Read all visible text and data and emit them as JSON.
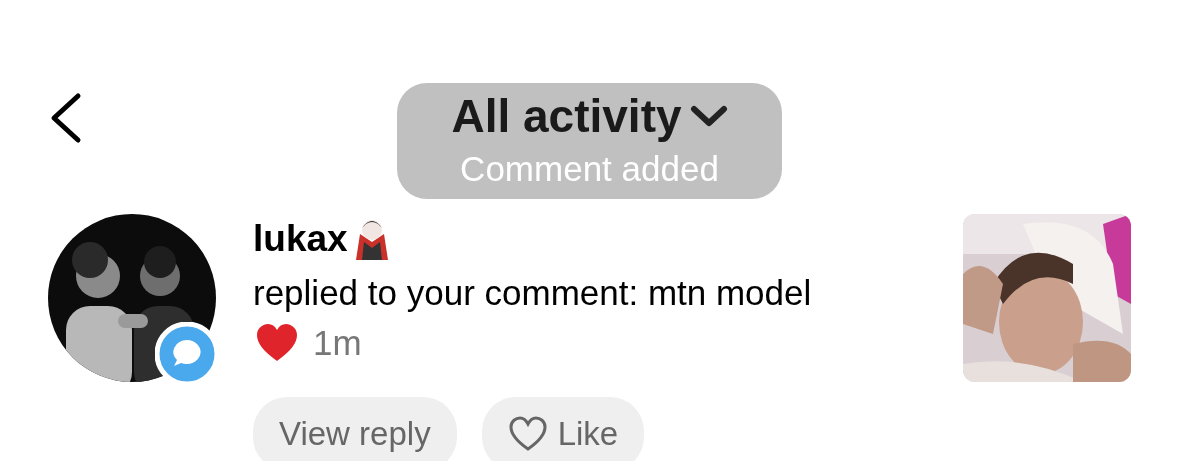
{
  "header": {
    "title": "All activity",
    "toast": "Comment added"
  },
  "notification": {
    "username": "lukax",
    "message": "replied to your comment: mtn model",
    "time": "1m"
  },
  "actions": [
    {
      "kind": "plain",
      "label": "View reply"
    },
    {
      "kind": "like",
      "label": "Like"
    }
  ]
}
